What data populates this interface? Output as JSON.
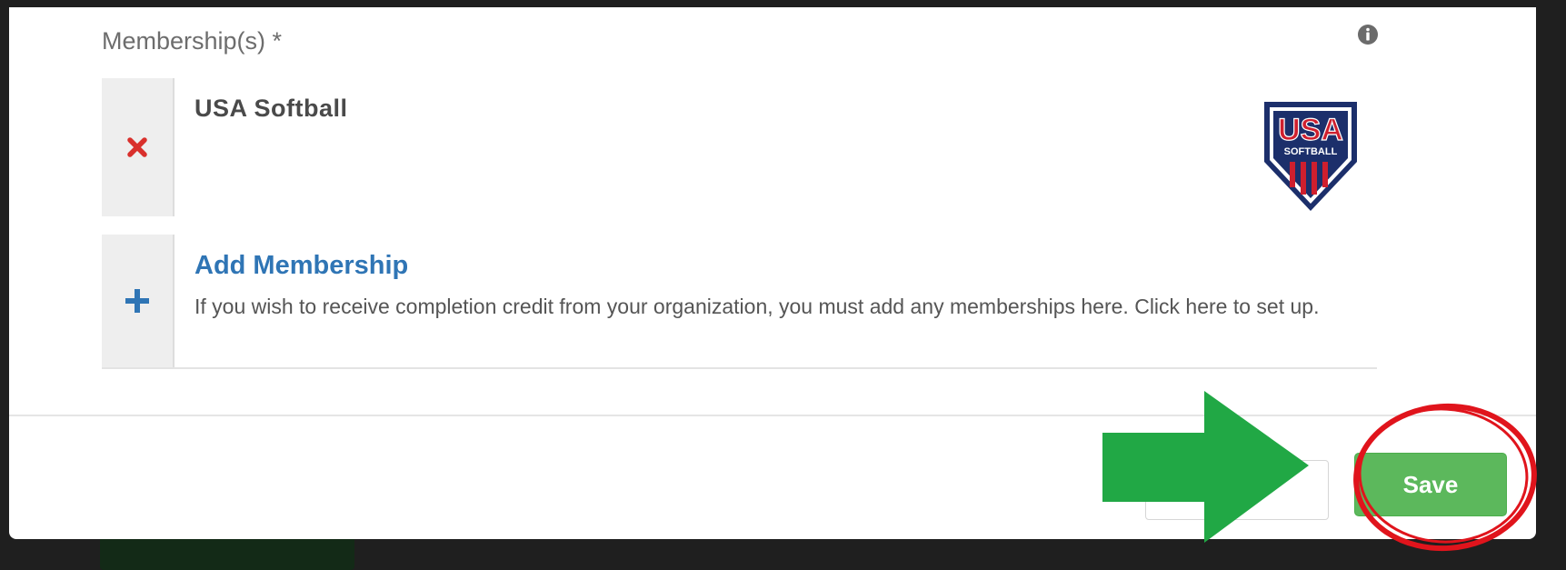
{
  "form": {
    "field_label": "Membership(s) *",
    "memberships": [
      {
        "name": "USA Softball",
        "logo_text": "USA",
        "logo_subtext": "SOFTBALL"
      }
    ],
    "add_membership": {
      "title": "Add Membership",
      "description": "If you wish to receive completion credit from your organization, you must add any memberships here. Click here to set up."
    }
  },
  "footer": {
    "save_label": "Save"
  },
  "icons": {
    "info": "info-circle-icon",
    "remove": "close-x-icon",
    "add": "plus-icon",
    "annotation_arrow": "arrow-right-icon",
    "annotation_circle": "highlight-circle"
  },
  "colors": {
    "save_button": "#5cb85c",
    "link": "#2f75b5",
    "remove_icon": "#d9302c",
    "annotation_arrow": "#21a845",
    "annotation_circle": "#e0141c",
    "logo_red": "#cf1f2e",
    "logo_navy": "#1c2f6b"
  }
}
